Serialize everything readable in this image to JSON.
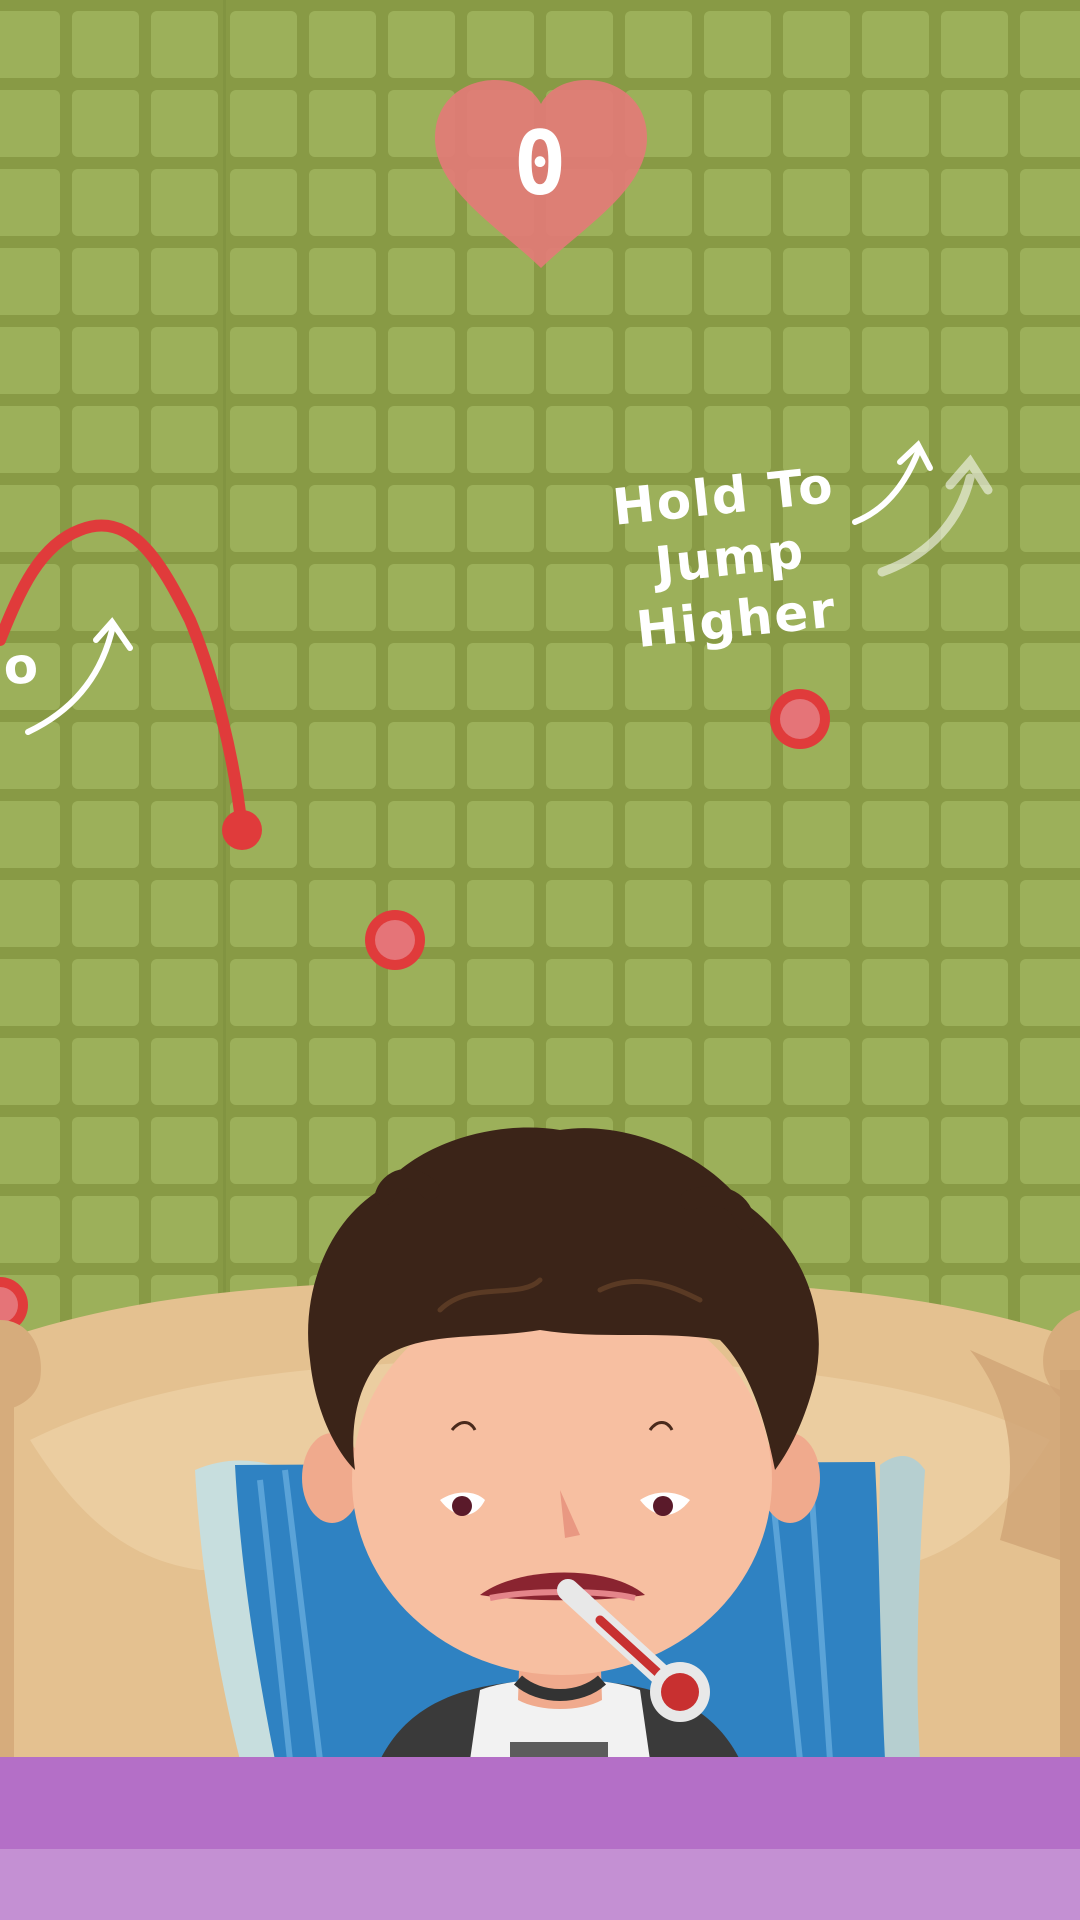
{
  "game": {
    "score": "0",
    "hint_hold": "Hold To Jump Higher",
    "hint_tap_fragment": "o"
  },
  "colors": {
    "wall_tile": "#9cb05a",
    "wall_grout": "#889a45",
    "accent_red": "#e03b3b",
    "heart": "#e47a78",
    "floor_top": "#b46fc7",
    "floor_bottom": "#c490d3",
    "sofa": "#e4c190",
    "pillow": "#2f82c2",
    "hair": "#3b2418",
    "skin": "#f7bfa1"
  },
  "icons": [
    "heart-icon",
    "curved-arrow-icon",
    "thermometer-icon"
  ]
}
